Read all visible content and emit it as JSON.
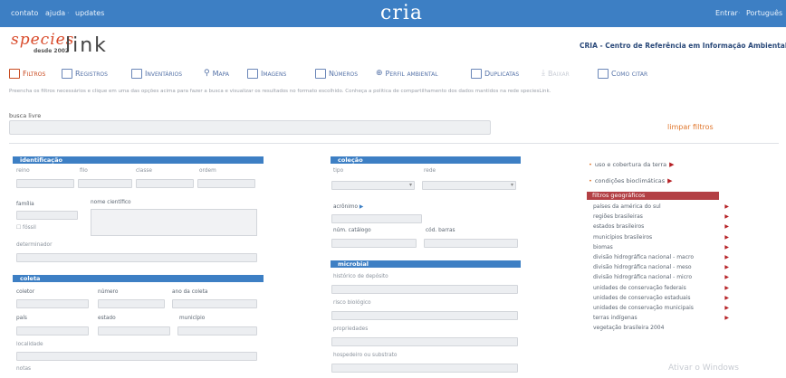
{
  "topbar": {
    "left_links": [
      "contato",
      "ajuda",
      "updates"
    ],
    "brand": "cria",
    "right_links": [
      "Entrar",
      "Português"
    ]
  },
  "logo": {
    "species": "species",
    "desde": "desde 2002",
    "link": "link"
  },
  "org_name": "CRIA - Centro de Referência em Informação Ambiental",
  "nav": [
    {
      "label": "Filtros",
      "icon": "filter-icon",
      "state": "active"
    },
    {
      "label": "Registros",
      "icon": "records-icon",
      "state": "normal"
    },
    {
      "label": "Inventários",
      "icon": "inventory-icon",
      "state": "normal"
    },
    {
      "label": "Mapa",
      "icon": "map-pin-icon",
      "state": "normal"
    },
    {
      "label": "Imagens",
      "icon": "images-icon",
      "state": "normal"
    },
    {
      "label": "Números",
      "icon": "numbers-icon",
      "state": "normal"
    },
    {
      "label": "Perfil ambiental",
      "icon": "globe-icon",
      "state": "normal"
    },
    {
      "label": "Duplicatas",
      "icon": "duplicates-icon",
      "state": "normal"
    },
    {
      "label": "Baixar",
      "icon": "download-icon",
      "state": "disabled"
    },
    {
      "label": "Como citar",
      "icon": "cite-icon",
      "state": "normal"
    }
  ],
  "instructions": "Preencha os filtros necessários e clique em uma das opções acima para fazer a busca e visualizar os resultados no formato escolhido. Conheça a política de compartilhamento dos dados mantidos na rede speciesLink.",
  "search": {
    "label": "busca livre",
    "value": "",
    "clear_label": "limpar filtros"
  },
  "identificacao": {
    "title": "identificação",
    "fields": {
      "reino": "reino",
      "filo": "filo",
      "classe": "classe",
      "ordem": "ordem",
      "familia": "família",
      "nome": "nome científico",
      "fossil": "fóssil",
      "determinador": "determinador"
    }
  },
  "coleta": {
    "title": "coleta",
    "fields": {
      "coletor": "coletor",
      "numero": "número",
      "ano": "ano da coleta",
      "pais": "país",
      "estado": "estado",
      "municipio": "município",
      "localidade": "localidade",
      "notas": "notas"
    }
  },
  "colecao": {
    "title": "coleção",
    "fields": {
      "tipo": "tipo",
      "rede": "rede",
      "acronimo": "acrônimo",
      "num_catalogo": "núm. catálogo",
      "cod_barras": "cód. barras"
    }
  },
  "microbial": {
    "title": "microbial",
    "fields": {
      "deposito": "histórico de depósito",
      "risco": "risco biológico",
      "propriedades": "propriedades",
      "hospedeiro": "hospedeiro ou substrato"
    }
  },
  "right": {
    "uso": "uso e cobertura da terra",
    "bioclim": "condições bioclimáticas",
    "geo_title": "filtros geográficos",
    "geo_items": [
      "países da américa do sul",
      "regiões brasileiras",
      "estados brasileiros",
      "municípios brasileiros",
      "biomas",
      "divisão hidrográfica nacional - macro",
      "divisão hidrográfica nacional - meso",
      "divisão hidrográfica nacional - micro",
      "unidades de conservação federais",
      "unidades de conservação estaduais",
      "unidades de conservação municipais",
      "terras indígenas",
      "vegetação brasileira 2004"
    ],
    "watermark": "Ativar o Windows"
  },
  "colors": {
    "header_blue": "#3d7fc4",
    "accent_orange": "#e0762c",
    "geo_red": "#b34045",
    "nav_blue": "#5673a8"
  }
}
